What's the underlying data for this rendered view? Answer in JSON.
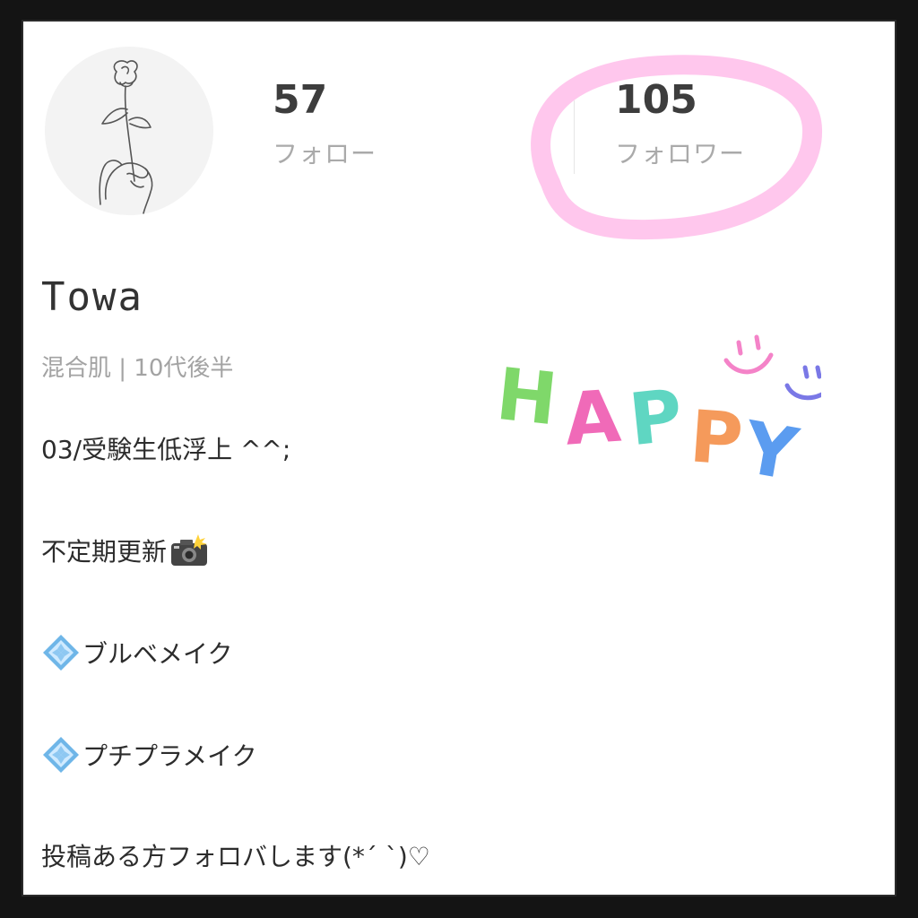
{
  "profile": {
    "following_count": "57",
    "following_label": "フォロー",
    "followers_count": "105",
    "followers_label": "フォロワー",
    "name": "Towa",
    "meta": "混合肌 | 10代後半",
    "bio": {
      "line1": "03/受験生低浮上 ^^;",
      "line2": "不定期更新",
      "line3": "ブルベメイク",
      "line4": "プチプラメイク",
      "line5": "投稿ある方フォロバします(*´ `)♡"
    }
  },
  "sticker": {
    "text": "HAPPY",
    "letters": [
      "H",
      "A",
      "P",
      "P",
      "Y"
    ],
    "letter_colors": [
      "#7fd86a",
      "#f06ab8",
      "#5fd6c2",
      "#f59a5b",
      "#5b9cf0"
    ]
  },
  "colors": {
    "highlight_circle": "#ffc4ec",
    "smiley_pink": "#f483c8",
    "smiley_blue": "#7a78e6"
  },
  "icons": {
    "avatar": "rose-line-art-icon",
    "camera": "camera-flash-icon",
    "diamond": "diamond-shape-icon"
  }
}
